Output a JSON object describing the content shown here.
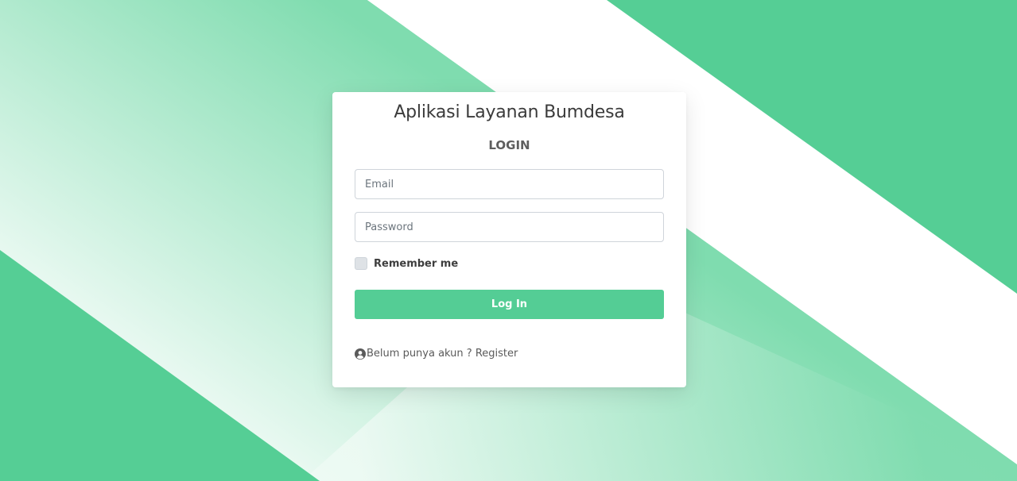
{
  "colors": {
    "accent": "#54cd95",
    "background_green": "#55ce95",
    "card": "#ffffff"
  },
  "login_card": {
    "title": "Aplikasi Layanan Bumdesa",
    "subtitle": "LOGIN",
    "email_placeholder": "Email",
    "password_placeholder": "Password",
    "remember_label": "Remember me",
    "remember_checked": false,
    "login_button_label": "Log In",
    "register_icon": "user-circle-icon",
    "register_link_label": "Belum punya akun ? Register"
  }
}
